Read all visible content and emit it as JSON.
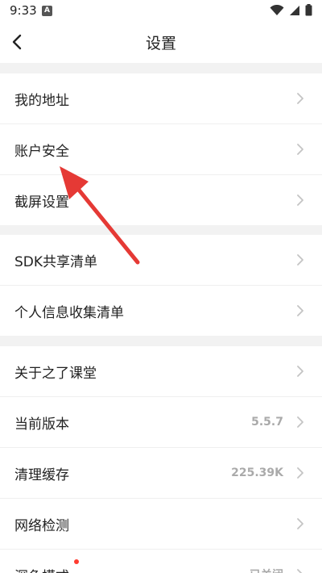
{
  "status_bar": {
    "time": "9:33",
    "notification_letter": "A",
    "icons": [
      "wifi-icon",
      "signal-icon",
      "battery-icon"
    ]
  },
  "header": {
    "title": "设置",
    "back_icon": "chevron-left-icon"
  },
  "groups": [
    {
      "items": [
        {
          "label": "我的地址"
        },
        {
          "label": "账户安全"
        },
        {
          "label": "截屏设置"
        }
      ]
    },
    {
      "items": [
        {
          "label": "SDK共享清单"
        },
        {
          "label": "个人信息收集清单"
        }
      ]
    },
    {
      "items": [
        {
          "label": "关于之了课堂"
        },
        {
          "label": "当前版本",
          "value": "5.5.7"
        },
        {
          "label": "清理缓存",
          "value": "225.39K"
        },
        {
          "label": "网络检测"
        },
        {
          "label": "深色模式",
          "value": "已关闭",
          "badge": "red-dot"
        }
      ]
    }
  ],
  "colors": {
    "background": "#f2f2f2",
    "card": "#ffffff",
    "annotation_arrow": "#e53935",
    "badge": "#ff3b30"
  }
}
